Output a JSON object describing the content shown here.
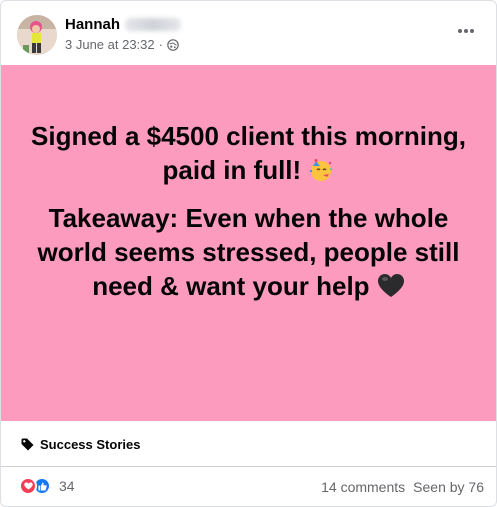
{
  "post": {
    "author": "Hannah",
    "timestamp": "3 June at 23:32",
    "separator": "·",
    "audience_icon": "globe-icon",
    "more_icon": "more-options-icon"
  },
  "content": {
    "background_color": "#fd9bbe",
    "paragraph1": "Signed a $4500 client this morning, paid in full!",
    "paragraph1_emoji": "partying-face-emoji",
    "paragraph2": "Takeaway: Even when the whole world seems stressed, people still need & want your help",
    "paragraph2_emoji": "black-heart-emoji"
  },
  "topic": {
    "icon": "tag-icon",
    "label": "Success Stories"
  },
  "footer": {
    "reaction_icons": [
      "love-reaction-icon",
      "like-reaction-icon"
    ],
    "reaction_count": "34",
    "comments": "14 comments",
    "seen_by": "Seen by 76"
  }
}
